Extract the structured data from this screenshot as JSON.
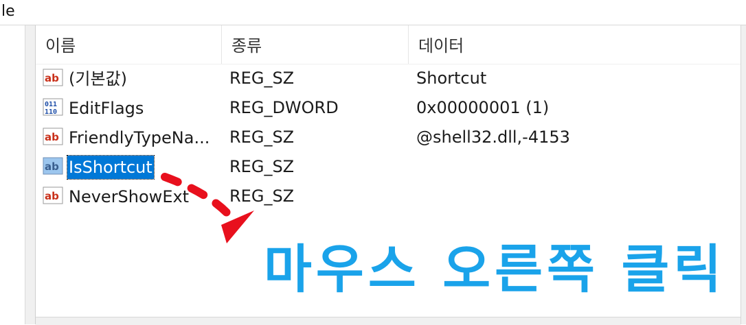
{
  "window": {
    "title_fragment": "le"
  },
  "list": {
    "columns": [
      {
        "label": "이름"
      },
      {
        "label": "종류"
      },
      {
        "label": "데이터"
      }
    ],
    "rows": [
      {
        "name": "(기본값)",
        "type": "REG_SZ",
        "data": "Shortcut",
        "icon": "string-value-icon",
        "selected": false
      },
      {
        "name": "EditFlags",
        "type": "REG_DWORD",
        "data": "0x00000001 (1)",
        "icon": "binary-value-icon",
        "selected": false
      },
      {
        "name": "FriendlyTypeNa...",
        "type": "REG_SZ",
        "data": "@shell32.dll,-4153",
        "icon": "string-value-icon",
        "selected": false
      },
      {
        "name": "IsShortcut",
        "type": "REG_SZ",
        "data": "",
        "icon": "string-value-icon",
        "selected": true
      },
      {
        "name": "NeverShowExt",
        "type": "REG_SZ",
        "data": "",
        "icon": "string-value-icon",
        "selected": false
      }
    ]
  },
  "annotation": {
    "caption": "마우스 오른쪽 클릭",
    "arrow_color": "#e8101d",
    "caption_color": "#1aa3ea"
  },
  "colors": {
    "selection": "#0078d7"
  }
}
